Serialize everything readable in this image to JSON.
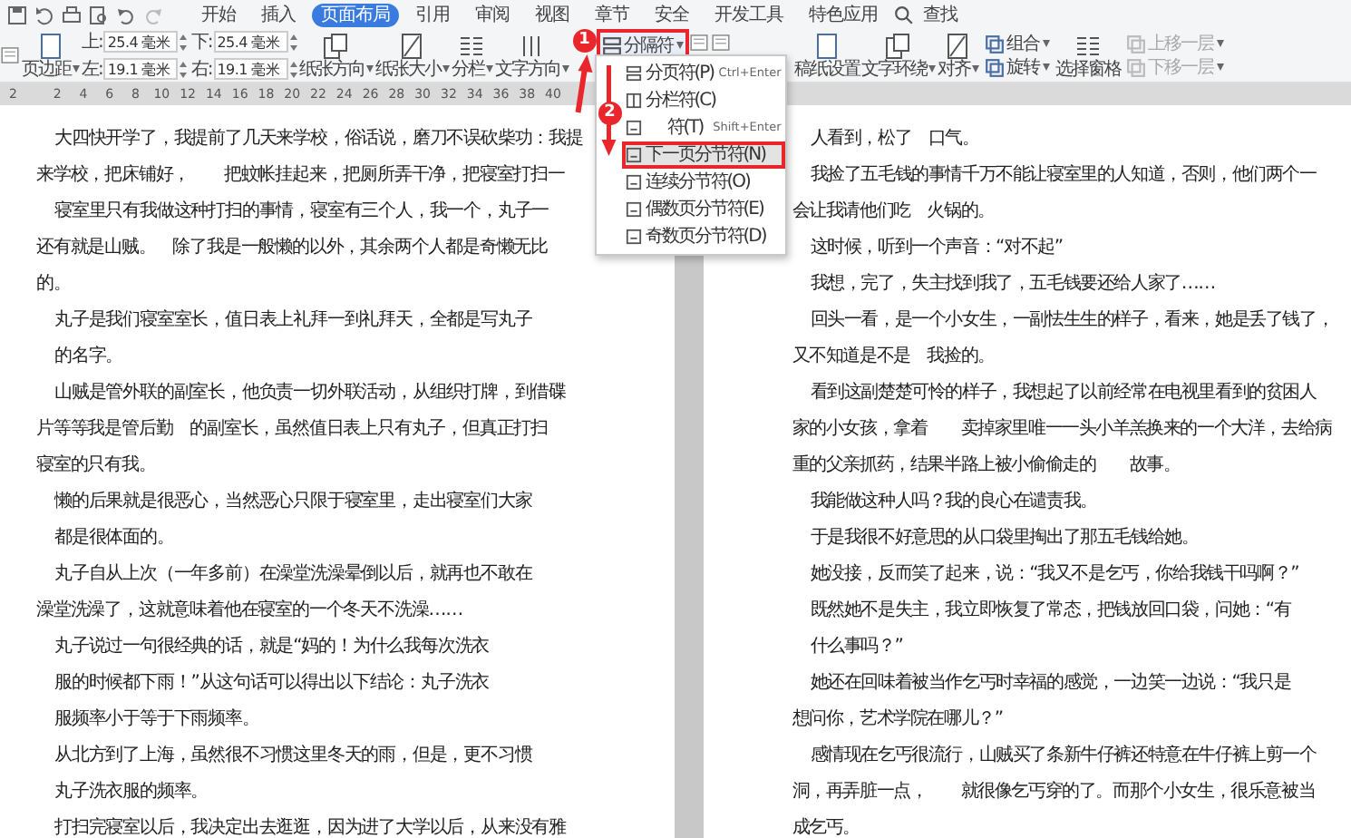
{
  "menu_tabs": [
    {
      "label": "开始",
      "selected": false
    },
    {
      "label": "插入",
      "selected": false
    },
    {
      "label": "页面布局",
      "selected": true
    },
    {
      "label": "引用",
      "selected": false
    },
    {
      "label": "审阅",
      "selected": false
    },
    {
      "label": "视图",
      "selected": false
    },
    {
      "label": "章节",
      "selected": false
    },
    {
      "label": "安全",
      "selected": false
    },
    {
      "label": "开发工具",
      "selected": false
    },
    {
      "label": "特色应用",
      "selected": false
    }
  ],
  "search": {
    "label": "查找"
  },
  "ribbon": [
    {
      "kind": "icon"
    },
    {
      "kind": "large",
      "label": "页边距",
      "dropdown": true
    },
    {
      "kind": "fields",
      "fields": [
        {
          "label": "上:",
          "value": "25.4 毫米"
        },
        {
          "label": "左:",
          "value": "19.1 毫米"
        },
        {
          "label": "下:",
          "value": "25.4 毫米"
        },
        {
          "label": "右:",
          "value": "19.1 毫米"
        }
      ]
    },
    {
      "kind": "large",
      "label": "纸张方向",
      "dropdown": true
    },
    {
      "kind": "large",
      "label": "纸张大小",
      "dropdown": true
    },
    {
      "kind": "large",
      "label": "分栏",
      "dropdown": true
    },
    {
      "kind": "large",
      "label": "文字方向",
      "dropdown": true
    },
    {
      "kind": "small",
      "label": "分隔符",
      "dropdown": true,
      "highlighted": true
    },
    {
      "kind": "icon"
    },
    {
      "kind": "icon"
    },
    {
      "kind": "large",
      "label": "稿纸设置",
      "dropdown": false
    },
    {
      "kind": "large",
      "label": "文字环绕",
      "dropdown": true
    },
    {
      "kind": "large",
      "label": "对齐",
      "dropdown": true
    },
    {
      "kind": "stack",
      "items": [
        {
          "label": "组合",
          "dropdown": true,
          "disabled": false
        },
        {
          "label": "旋转",
          "dropdown": true,
          "disabled": false
        }
      ]
    },
    {
      "kind": "large",
      "label": "选择窗格",
      "dropdown": false
    },
    {
      "kind": "stack",
      "items": [
        {
          "label": "上移一层",
          "dropdown": true,
          "disabled": true
        },
        {
          "label": "下移一层",
          "dropdown": true,
          "disabled": true
        }
      ]
    }
  ],
  "ruler": {
    "labels": [
      "2",
      "2",
      "4",
      "6",
      "8",
      "10",
      "12",
      "14",
      "16",
      "18",
      "20",
      "22",
      "24",
      "26",
      "28",
      "30",
      "32",
      "34",
      "36",
      "38",
      "40"
    ]
  },
  "dropdown_menu": [
    {
      "label": "分页符(P)",
      "shortcut": "Ctrl+Enter",
      "selected": false,
      "obscured": false
    },
    {
      "label": "分栏符(C)",
      "selected": false,
      "obscured": false
    },
    {
      "label": "符(T)",
      "shortcut": "Shift+Enter",
      "selected": false,
      "obscured": true
    },
    {
      "label": "下一页分节符(N)",
      "selected": true,
      "obscured": false
    },
    {
      "label": "连续分节符(O)",
      "selected": false,
      "obscured": false
    },
    {
      "label": "偶数页分节符(E)",
      "selected": false,
      "obscured": false
    },
    {
      "label": "奇数页分节符(D)",
      "selected": false,
      "obscured": false
    }
  ],
  "annotations": [
    {
      "label": "1"
    },
    {
      "label": "2"
    }
  ],
  "left_page": [
    {
      "text": "大四快开学了，我提前了几天来学校，俗话说，磨刀不误砍柴功：我提",
      "indent": true
    },
    {
      "text": "来学校，把床铺好，　　把蚊帐挂起来，把厕所弄干净，把寝室打扫一",
      "indent": false
    },
    {
      "text": "寝室里只有我做这种打扫的事情，寝室有三个人，我一个，丸子一",
      "indent": true
    },
    {
      "text": "还有就是山贼。　除了我是一般懒的以外，其余两个人都是奇懒无比",
      "indent": false
    },
    {
      "text": "的。",
      "indent": false
    },
    {
      "text": "丸子是我们寝室室长，值日表上礼拜一到礼拜天，全都是写丸子",
      "indent": true
    },
    {
      "text": "的名字。",
      "indent": true
    },
    {
      "text": "山贼是管外联的副室长，他负责一切外联活动，从组织打牌，到借碟",
      "indent": true
    },
    {
      "text": "片等等我是管后勤　的副室长，虽然值日表上只有丸子，但真正打扫",
      "indent": false
    },
    {
      "text": "寝室的只有我。",
      "indent": false
    },
    {
      "text": "懒的后果就是很恶心，当然恶心只限于寝室里，走出寝室们大家",
      "indent": true
    },
    {
      "text": "都是很体面的。",
      "indent": true
    },
    {
      "text": "丸子自从上次（一年多前）在澡堂洗澡晕倒以后，就再也不敢在",
      "indent": true
    },
    {
      "text": "澡堂洗澡了，这就意味着他在寝室的一个冬天不洗澡……",
      "indent": false
    },
    {
      "text": "丸子说过一句很经典的话，就是“妈的！为什么我每次洗衣",
      "indent": true
    },
    {
      "text": "服的时候都下雨！”从这句话可以得出以下结论：丸子洗衣",
      "indent": true
    },
    {
      "text": "服频率小于等于下雨频率。",
      "indent": true
    },
    {
      "text": "从北方到了上海，虽然很不习惯这里冬天的雨，但是，更不习惯",
      "indent": true
    },
    {
      "text": "丸子洗衣服的频率。",
      "indent": true
    },
    {
      "text": "打扫完寝室以后，我决定出去逛逛，因为进了大学以后，从来没有雅",
      "indent": true
    }
  ],
  "right_page": [
    {
      "text": "人看到，松了　口气。",
      "indent": true
    },
    {
      "text": "我捡了五毛钱的事情千万不能让寝室里的人知道，否则，他们两个一",
      "indent": true
    },
    {
      "text": "会让我请他们吃　火锅的。",
      "indent": false
    },
    {
      "text": "这时候，听到一个声音：“对不起”",
      "indent": true
    },
    {
      "text": "我想，完了，失主找到我了，五毛钱要还给人家了……",
      "indent": true
    },
    {
      "text": "回头一看，是一个小女生，一副怯生生的样子，看来，她是丢了钱了，",
      "indent": true
    },
    {
      "text": "又不知道是不是　我捡的。",
      "indent": false
    },
    {
      "text": "看到这副楚楚可怜的样子，我想起了以前经常在电视里看到的贫困人",
      "indent": true
    },
    {
      "text": "家的小女孩，拿着　　卖掉家里唯一一头小羊羔换来的一个大洋，去给病",
      "indent": false
    },
    {
      "text": "重的父亲抓药，结果半路上被小偷偷走的　　故事。",
      "indent": false
    },
    {
      "text": "我能做这种人吗？我的良心在谴责我。",
      "indent": true
    },
    {
      "text": "于是我很不好意思的从口袋里掏出了那五毛钱给她。",
      "indent": true
    },
    {
      "text": "她没接，反而笑了起来，说：“我又不是乞丐，你给我钱干吗啊？”",
      "indent": true
    },
    {
      "text": "既然她不是失主，我立即恢复了常态，把钱放回口袋，问她：“有",
      "indent": true
    },
    {
      "text": "什么事吗？”",
      "indent": true
    },
    {
      "text": "她还在回味着被当作乞丐时幸福的感觉，一边笑一边说：“我只是",
      "indent": true
    },
    {
      "text": "想问你，艺术学院在哪儿？”",
      "indent": false
    },
    {
      "text": "感情现在乞丐很流行，山贼买了条新牛仔裤还特意在牛仔裤上剪一个",
      "indent": true
    },
    {
      "text": "洞，再弄脏一点，　　就很像乞丐穿的了。而那个小女生，很乐意被当",
      "indent": false
    },
    {
      "text": "成乞丐。",
      "indent": false
    }
  ]
}
